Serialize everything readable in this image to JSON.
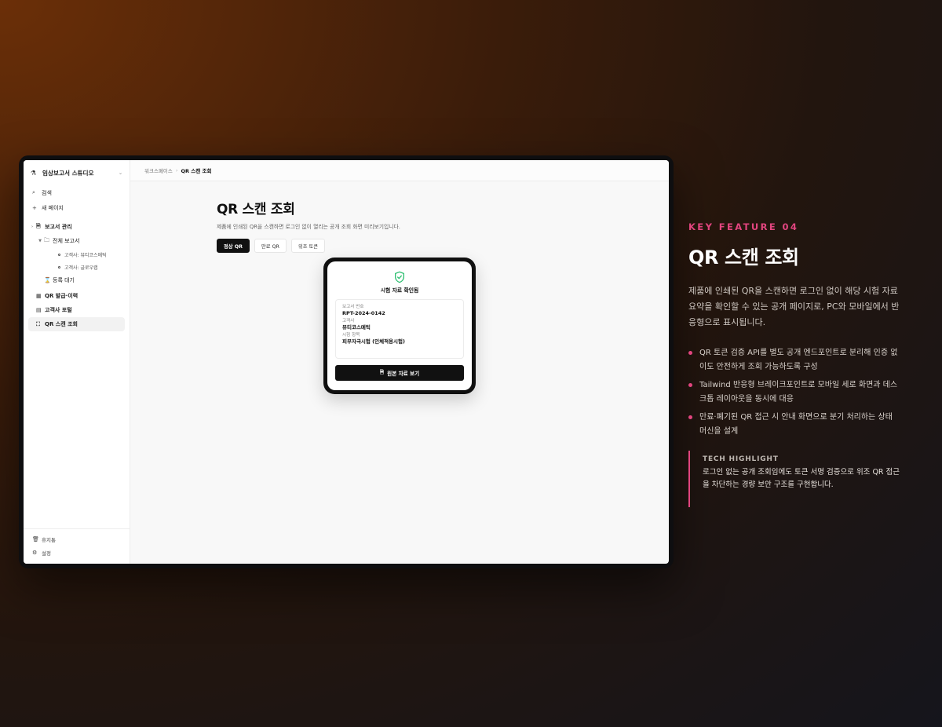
{
  "colors": {
    "accent": "#e2457f",
    "success": "#2fbf71",
    "primary_button": "#111111"
  },
  "app": {
    "workspace": "임상보고서 스튜디오",
    "sidebar": {
      "search": "검색",
      "new_page": "새 페이지",
      "report_mgmt": "보고서 관리",
      "all_reports": "전체 보고서",
      "client_beauty": "고객사: 뷰티코스메틱",
      "client_global": "고객사: 글로우랩",
      "pending": "등록 대기",
      "qr_issue": "QR 발급·이력",
      "client_portal": "고객사 포털",
      "qr_scan": "QR 스캔 조회",
      "trash": "휴지통",
      "settings": "설정"
    },
    "breadcrumb": {
      "root": "워크스페이스",
      "sep": "›",
      "current": "QR 스캔 조회"
    },
    "page": {
      "title": "QR 스캔 조회",
      "description": "제품에 인쇄된 QR을 스캔하면 로그인 없이 열리는 공개 조회 화면 미리보기입니다.",
      "tabs": [
        "정상 QR",
        "만료 QR",
        "위조 토큰"
      ]
    },
    "card": {
      "title": "시험 자료 확인됨",
      "fields": [
        {
          "label": "보고서 번호",
          "value": "RPT-2024-0142"
        },
        {
          "label": "고객사",
          "value": "뷰티코스메틱"
        },
        {
          "label": "시험 항목",
          "value": "피부자극시험 (인체적용시험)"
        }
      ],
      "button": "원본 자료 보기"
    }
  },
  "panel": {
    "kicker": "KEY FEATURE 04",
    "title": "QR 스캔 조회",
    "description": "제품에 인쇄된 QR을 스캔하면 로그인 없이 해당 시험 자료 요약을 확인할 수 있는 공개 페이지로, PC와 모바일에서 반응형으로 표시됩니다.",
    "bullets": [
      "QR 토큰 검증 API를 별도 공개 엔드포인트로 분리해 인증 없이도 안전하게 조회 가능하도록 구성",
      "Tailwind 반응형 브레이크포인트로 모바일 세로 화면과 데스크톱 레이아웃을 동시에 대응",
      "만료·폐기된 QR 접근 시 안내 화면으로 분기 처리하는 상태 머신을 설계"
    ],
    "highlight_heading": "TECH HIGHLIGHT",
    "highlight_text": "로그인 없는 공개 조회임에도 토큰 서명 검증으로 위조 QR 접근을 차단하는 경량 보안 구조를 구현합니다."
  }
}
